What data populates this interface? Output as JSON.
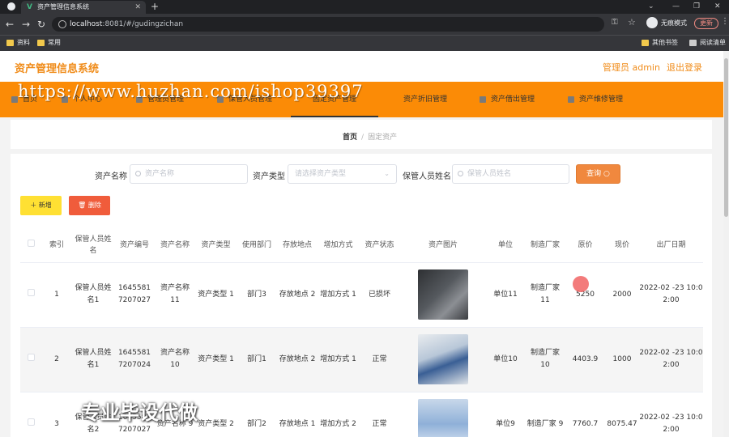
{
  "browser": {
    "tab_title": "资产管理信息系统",
    "url_host": "localhost",
    "url_rest": ":8081/#/gudingzichan",
    "incognito_label": "无痕模式",
    "update_label": "更新",
    "bookmarks": [
      "资料",
      "常用"
    ],
    "bookmarks_right": [
      "其他书签",
      "阅读清单"
    ]
  },
  "header": {
    "title": "资产管理信息系统",
    "admin": "管理员 admin",
    "logout": "退出登录"
  },
  "nav": {
    "items": [
      "首页",
      "个人中心",
      "管理员管理",
      "保管人员管理",
      "固定资产管理",
      "资产折旧管理",
      "资产借出管理",
      "资产维修管理"
    ]
  },
  "breadcrumb": {
    "home": "首页",
    "sep": "/",
    "current": "固定资产"
  },
  "search": {
    "name_label": "资产名称",
    "name_placeholder": "资产名称",
    "type_label": "资产类型",
    "type_placeholder": "请选择资产类型",
    "keeper_label": "保管人员姓名",
    "keeper_placeholder": "保管人员姓名",
    "query_label": "查询"
  },
  "actions": {
    "add_label": "新增",
    "delete_label": "删除"
  },
  "table": {
    "headers": [
      "索引",
      "保管人员姓名",
      "资产编号",
      "资产名称",
      "资产类型",
      "使用部门",
      "存放地点",
      "增加方式",
      "资产状态",
      "资产图片",
      "单位",
      "制造厂家",
      "原价",
      "现价",
      "出厂日期"
    ],
    "rows": [
      {
        "index": "1",
        "keeper": "保管人员姓名1",
        "code": "1645581 7207027",
        "name": "资产名称 11",
        "type": "资产类型 1",
        "dept": "部门3",
        "location": "存放地点 2",
        "method": "增加方式 1",
        "status": "已损坏",
        "unit": "单位11",
        "maker": "制造厂家 11",
        "price": "5250",
        "current": "2000",
        "date": "2022-02 -23 10:0 2:00"
      },
      {
        "index": "2",
        "keeper": "保管人员姓名1",
        "code": "1645581 7207024",
        "name": "资产名称 10",
        "type": "资产类型 1",
        "dept": "部门1",
        "location": "存放地点 2",
        "method": "增加方式 1",
        "status": "正常",
        "unit": "单位10",
        "maker": "制造厂家 10",
        "price": "4403.9",
        "current": "1000",
        "date": "2022-02 -23 10:0 2:00"
      },
      {
        "index": "3",
        "keeper": "保管人员姓名2",
        "code": "1645581 7207027",
        "name": "资产名称 9",
        "type": "资产类型 2",
        "dept": "部门2",
        "location": "存放地点 1",
        "method": "增加方式 2",
        "status": "正常",
        "unit": "单位9",
        "maker": "制造厂家 9",
        "price": "7760.7",
        "current": "8075.47",
        "date": "2022-02 -23 10:0 2:00"
      }
    ]
  },
  "overlay": {
    "watermark": "https://www.huzhan.com/ishop39397",
    "promo": "专业毕设代做"
  }
}
